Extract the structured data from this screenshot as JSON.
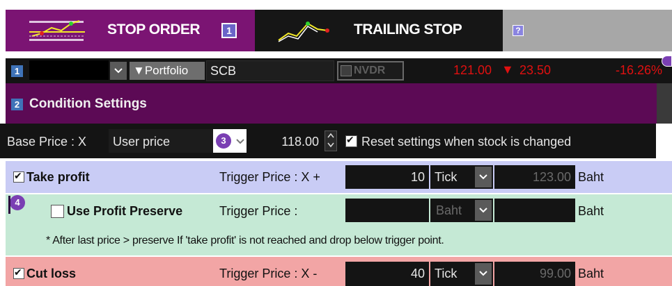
{
  "tabs": {
    "stop_order": {
      "label": "STOP ORDER",
      "badge": "1"
    },
    "trailing_stop": {
      "label": "TRAILING STOP",
      "badge": "?"
    }
  },
  "section1": {
    "badge": "1",
    "portfolio_label": "▼Portfolio",
    "symbol": "SCB",
    "nvdr_label": "NVDR",
    "last_price": "121.00",
    "change_arrow": "▼",
    "change": "23.50",
    "change_pct": "-16.26%"
  },
  "section2": {
    "badge": "2",
    "title": "Condition Settings",
    "base_price_label": "Base Price : X",
    "base_price_type": "User price",
    "badge3": "3",
    "base_price_value": "118.00",
    "reset_label": "Reset settings when stock is changed"
  },
  "take_profit": {
    "label": "Take profit",
    "trigger_label": "Trigger Price : X +",
    "offset": "10",
    "unit": "Tick",
    "price": "123.00",
    "currency": "Baht"
  },
  "profit_preserve": {
    "badge": "4",
    "label": "Use Profit Preserve",
    "trigger_label": "Trigger Price :",
    "unit": "Baht",
    "currency": "Baht",
    "note": "* After last price > preserve If 'take profit' is not reached and drop below trigger point."
  },
  "cut_loss": {
    "label": "Cut loss",
    "trigger_label": "Trigger Price : X -",
    "offset": "40",
    "unit": "Tick",
    "price": "99.00",
    "currency": "Baht"
  },
  "colors": {
    "tab_active": "#7b1473",
    "tab_inactive": "#161616",
    "header_purple": "#5c0a55",
    "price_red": "#e01010",
    "take_profit_bg": "#c9ccf5",
    "preserve_bg": "#c5e9d5",
    "cut_loss_bg": "#f2a5a5"
  }
}
